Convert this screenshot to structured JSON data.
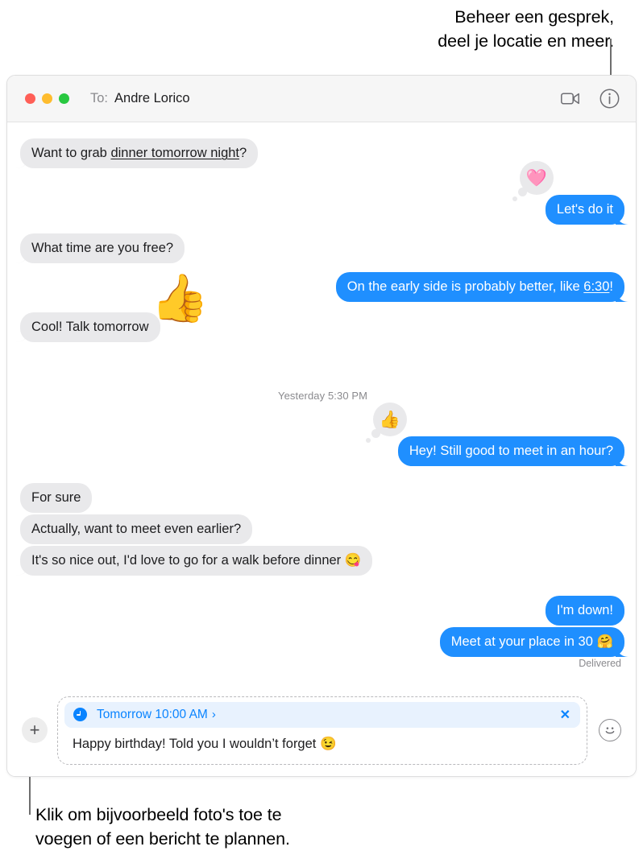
{
  "callouts": {
    "top": "Beheer een gesprek,\ndeel je locatie en meer.",
    "bottom": "Klik om bijvoorbeeld foto's toe te\nvoegen of een bericht te plannen."
  },
  "window": {
    "titlebar": {
      "to_label": "To:",
      "recipient": "Andre Lorico",
      "facetime_icon": "video-camera-icon",
      "info_icon": "info-circle-icon",
      "traffic_lights": {
        "close": "#ff5f57",
        "minimize": "#febc2e",
        "zoom": "#28c840"
      }
    },
    "conversation": {
      "timestamp": "Yesterday 5:30 PM",
      "delivered_label": "Delivered",
      "messages": [
        {
          "id": "m1",
          "side": "them",
          "text": "Want to grab dinner tomorrow night?",
          "link_text": "dinner tomorrow night"
        },
        {
          "id": "m2",
          "side": "me",
          "text": "Let's do it",
          "tapback": "🩷"
        },
        {
          "id": "m3",
          "side": "them",
          "text": "What time are you free?"
        },
        {
          "id": "m4",
          "side": "me",
          "text": "On the early side is probably better, like 6:30!",
          "link_text": "6:30"
        },
        {
          "id": "m5",
          "side": "them",
          "text": "Cool! Talk tomorrow",
          "sticker": "👍"
        },
        {
          "id": "m6",
          "side": "me",
          "text": "Hey! Still good to meet in an hour?",
          "tapback": "👍"
        },
        {
          "id": "m7",
          "side": "them",
          "text": "For sure"
        },
        {
          "id": "m8",
          "side": "them",
          "text": "Actually, want to meet even earlier?"
        },
        {
          "id": "m9",
          "side": "them",
          "text": "It's so nice out, I'd love to go for a walk before dinner 😋"
        },
        {
          "id": "m10",
          "side": "me",
          "text": "I'm down!"
        },
        {
          "id": "m11",
          "side": "me",
          "text": "Meet at your place in 30 🤗"
        }
      ]
    },
    "composer": {
      "plus_label": "+",
      "plus_icon": "plus-icon",
      "schedule": {
        "clock_icon": "clock-icon",
        "label": "Tomorrow 10:00 AM",
        "chevron": "›",
        "close_label": "✕"
      },
      "draft_text": "Happy birthday! Told you I wouldn’t forget 😉",
      "emoji_icon": "smiley-face-icon"
    }
  }
}
